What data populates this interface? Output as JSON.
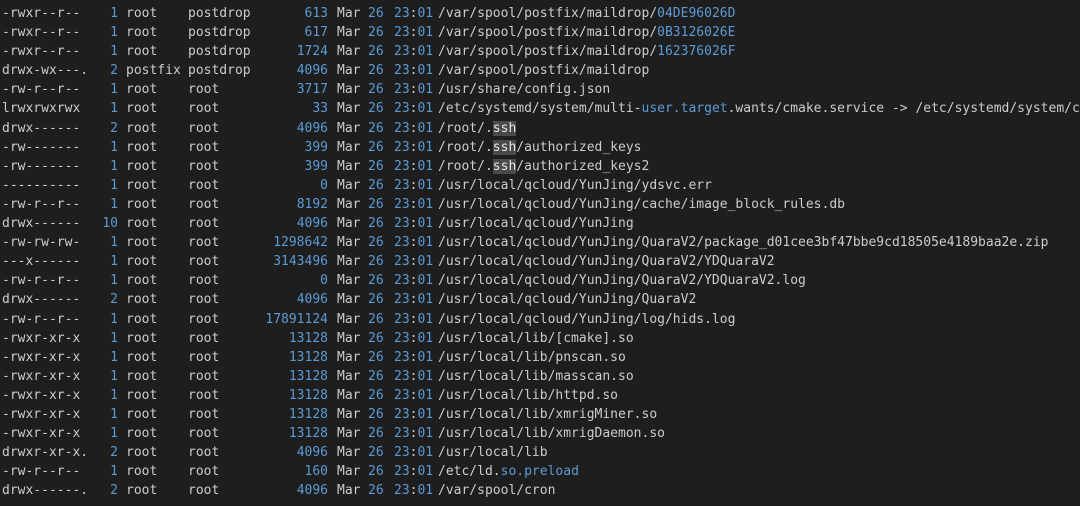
{
  "rows": [
    {
      "perm": "-rwxr--r--",
      "links": "1",
      "owner": "root",
      "group": "postdrop",
      "size": "613",
      "month": "Mar",
      "day": "26",
      "hour": "23",
      "min": "01",
      "path": [
        {
          "t": "/var/spool/postfix/maildrop/"
        },
        {
          "t": "04DE96026D",
          "c": "hl"
        }
      ]
    },
    {
      "perm": "-rwxr--r--",
      "links": "1",
      "owner": "root",
      "group": "postdrop",
      "size": "617",
      "month": "Mar",
      "day": "26",
      "hour": "23",
      "min": "01",
      "path": [
        {
          "t": "/var/spool/postfix/maildrop/"
        },
        {
          "t": "0B3126026E",
          "c": "hl"
        }
      ]
    },
    {
      "perm": "-rwxr--r--",
      "links": "1",
      "owner": "root",
      "group": "postdrop",
      "size": "1724",
      "month": "Mar",
      "day": "26",
      "hour": "23",
      "min": "01",
      "path": [
        {
          "t": "/var/spool/postfix/maildrop/"
        },
        {
          "t": "162376026F",
          "c": "hl"
        }
      ]
    },
    {
      "perm": "drwx-wx---.",
      "links": "2",
      "owner": "postfix",
      "group": "postdrop",
      "size": "4096",
      "month": "Mar",
      "day": "26",
      "hour": "23",
      "min": "01",
      "path": [
        {
          "t": "/var/spool/postfix/maildrop"
        }
      ]
    },
    {
      "perm": "-rw-r--r--",
      "links": "1",
      "owner": "root",
      "group": "root",
      "size": "3717",
      "month": "Mar",
      "day": "26",
      "hour": "23",
      "min": "01",
      "path": [
        {
          "t": "/usr/share/config.json"
        }
      ]
    },
    {
      "perm": "lrwxrwxrwx",
      "links": "1",
      "owner": "root",
      "group": "root",
      "size": "33",
      "month": "Mar",
      "day": "26",
      "hour": "23",
      "min": "01",
      "path": [
        {
          "t": "/etc/systemd/system/multi-"
        },
        {
          "t": "user.target",
          "c": "hl"
        },
        {
          "t": ".wants/cmake.service -> /etc/systemd/system/cma"
        }
      ]
    },
    {
      "perm": "drwx------",
      "links": "2",
      "owner": "root",
      "group": "root",
      "size": "4096",
      "month": "Mar",
      "day": "26",
      "hour": "23",
      "min": "01",
      "path": [
        {
          "t": "/root/."
        },
        {
          "t": "ssh",
          "c": "cursor-cell"
        }
      ]
    },
    {
      "perm": "-rw-------",
      "links": "1",
      "owner": "root",
      "group": "root",
      "size": "399",
      "month": "Mar",
      "day": "26",
      "hour": "23",
      "min": "01",
      "path": [
        {
          "t": "/root/."
        },
        {
          "t": "ssh",
          "c": "cursor-cell"
        },
        {
          "t": "/authorized_keys"
        }
      ]
    },
    {
      "perm": "-rw-------",
      "links": "1",
      "owner": "root",
      "group": "root",
      "size": "399",
      "month": "Mar",
      "day": "26",
      "hour": "23",
      "min": "01",
      "path": [
        {
          "t": "/root/."
        },
        {
          "t": "ssh",
          "c": "cursor-cell"
        },
        {
          "t": "/authorized_keys2"
        }
      ]
    },
    {
      "perm": "----------",
      "links": "1",
      "owner": "root",
      "group": "root",
      "size": "0",
      "month": "Mar",
      "day": "26",
      "hour": "23",
      "min": "01",
      "path": [
        {
          "t": "/usr/local/qcloud/YunJing/ydsvc.err"
        }
      ]
    },
    {
      "perm": "-rw-r--r--",
      "links": "1",
      "owner": "root",
      "group": "root",
      "size": "8192",
      "month": "Mar",
      "day": "26",
      "hour": "23",
      "min": "01",
      "path": [
        {
          "t": "/usr/local/qcloud/YunJing/cache/image_block_rules.db"
        }
      ]
    },
    {
      "perm": "drwx------",
      "links": "10",
      "owner": "root",
      "group": "root",
      "size": "4096",
      "month": "Mar",
      "day": "26",
      "hour": "23",
      "min": "01",
      "path": [
        {
          "t": "/usr/local/qcloud/YunJing"
        }
      ]
    },
    {
      "perm": "-rw-rw-rw-",
      "links": "1",
      "owner": "root",
      "group": "root",
      "size": "1298642",
      "month": "Mar",
      "day": "26",
      "hour": "23",
      "min": "01",
      "path": [
        {
          "t": "/usr/local/qcloud/YunJing/QuaraV2/package_d01cee3bf47bbe9cd18505e4189baa2e.zip"
        }
      ]
    },
    {
      "perm": "---x------",
      "links": "1",
      "owner": "root",
      "group": "root",
      "size": "3143496",
      "month": "Mar",
      "day": "26",
      "hour": "23",
      "min": "01",
      "path": [
        {
          "t": "/usr/local/qcloud/YunJing/QuaraV2/YDQuaraV2"
        }
      ]
    },
    {
      "perm": "-rw-r--r--",
      "links": "1",
      "owner": "root",
      "group": "root",
      "size": "0",
      "month": "Mar",
      "day": "26",
      "hour": "23",
      "min": "01",
      "path": [
        {
          "t": "/usr/local/qcloud/YunJing/QuaraV2/YDQuaraV2.log"
        }
      ]
    },
    {
      "perm": "drwx------",
      "links": "2",
      "owner": "root",
      "group": "root",
      "size": "4096",
      "month": "Mar",
      "day": "26",
      "hour": "23",
      "min": "01",
      "path": [
        {
          "t": "/usr/local/qcloud/YunJing/QuaraV2"
        }
      ]
    },
    {
      "perm": "-rw-r--r--",
      "links": "1",
      "owner": "root",
      "group": "root",
      "size": "17891124",
      "month": "Mar",
      "day": "26",
      "hour": "23",
      "min": "01",
      "path": [
        {
          "t": "/usr/local/qcloud/YunJing/log/hids.log"
        }
      ]
    },
    {
      "perm": "-rwxr-xr-x",
      "links": "1",
      "owner": "root",
      "group": "root",
      "size": "13128",
      "month": "Mar",
      "day": "26",
      "hour": "23",
      "min": "01",
      "path": [
        {
          "t": "/usr/local/lib/[cmake].so"
        }
      ]
    },
    {
      "perm": "-rwxr-xr-x",
      "links": "1",
      "owner": "root",
      "group": "root",
      "size": "13128",
      "month": "Mar",
      "day": "26",
      "hour": "23",
      "min": "01",
      "path": [
        {
          "t": "/usr/local/lib/pnscan.so"
        }
      ]
    },
    {
      "perm": "-rwxr-xr-x",
      "links": "1",
      "owner": "root",
      "group": "root",
      "size": "13128",
      "month": "Mar",
      "day": "26",
      "hour": "23",
      "min": "01",
      "path": [
        {
          "t": "/usr/local/lib/masscan.so"
        }
      ]
    },
    {
      "perm": "-rwxr-xr-x",
      "links": "1",
      "owner": "root",
      "group": "root",
      "size": "13128",
      "month": "Mar",
      "day": "26",
      "hour": "23",
      "min": "01",
      "path": [
        {
          "t": "/usr/local/lib/httpd.so"
        }
      ]
    },
    {
      "perm": "-rwxr-xr-x",
      "links": "1",
      "owner": "root",
      "group": "root",
      "size": "13128",
      "month": "Mar",
      "day": "26",
      "hour": "23",
      "min": "01",
      "path": [
        {
          "t": "/usr/local/lib/xmrigMiner.so"
        }
      ]
    },
    {
      "perm": "-rwxr-xr-x",
      "links": "1",
      "owner": "root",
      "group": "root",
      "size": "13128",
      "month": "Mar",
      "day": "26",
      "hour": "23",
      "min": "01",
      "path": [
        {
          "t": "/usr/local/lib/xmrigDaemon.so"
        }
      ]
    },
    {
      "perm": "drwxr-xr-x.",
      "links": "2",
      "owner": "root",
      "group": "root",
      "size": "4096",
      "month": "Mar",
      "day": "26",
      "hour": "23",
      "min": "01",
      "path": [
        {
          "t": "/usr/local/lib"
        }
      ]
    },
    {
      "perm": "-rw-r--r--",
      "links": "1",
      "owner": "root",
      "group": "root",
      "size": "160",
      "month": "Mar",
      "day": "26",
      "hour": "23",
      "min": "01",
      "path": [
        {
          "t": "/etc/ld."
        },
        {
          "t": "so.preload",
          "c": "hl"
        }
      ]
    },
    {
      "perm": "drwx------.",
      "links": "2",
      "owner": "root",
      "group": "root",
      "size": "4096",
      "month": "Mar",
      "day": "26",
      "hour": "23",
      "min": "01",
      "path": [
        {
          "t": "/var/spool/cron"
        }
      ]
    }
  ],
  "colors": {
    "background": "#1e1e1e",
    "text": "#cccccc",
    "number_highlight": "#5b9bd5",
    "cursor_cell": "#4a4a4a"
  }
}
